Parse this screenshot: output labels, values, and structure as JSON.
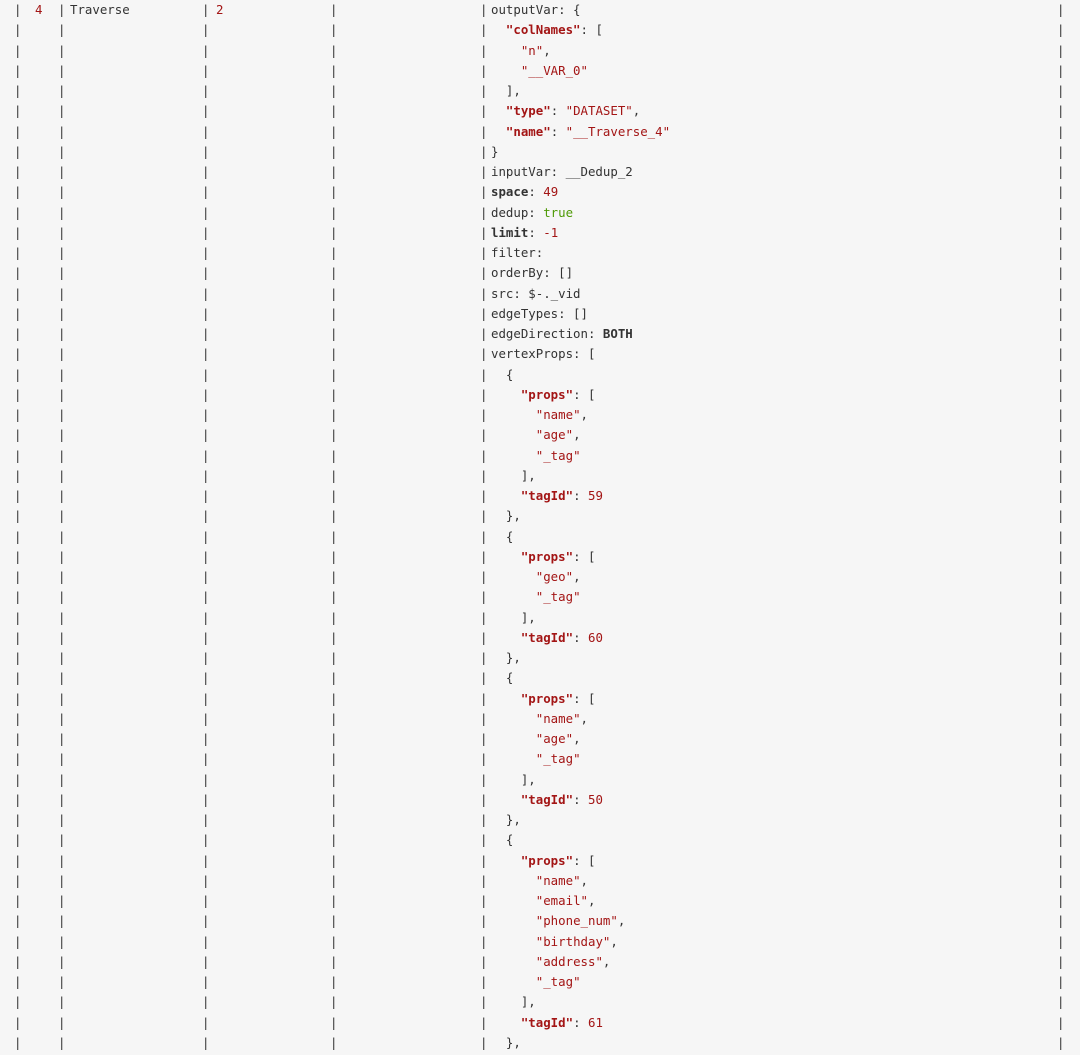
{
  "row": {
    "id": "4",
    "name": "Traverse",
    "dependencies": "2"
  },
  "operator_info": [
    [
      [
        "p",
        "outputVar: {"
      ]
    ],
    [
      [
        "p",
        "  "
      ],
      [
        "k",
        "\"colNames\""
      ],
      [
        "p",
        ": ["
      ]
    ],
    [
      [
        "p",
        "    "
      ],
      [
        "s",
        "\"n\""
      ],
      [
        "p",
        ","
      ]
    ],
    [
      [
        "p",
        "    "
      ],
      [
        "s",
        "\"__VAR_0\""
      ]
    ],
    [
      [
        "p",
        "  ],"
      ]
    ],
    [
      [
        "p",
        "  "
      ],
      [
        "k",
        "\"type\""
      ],
      [
        "p",
        ": "
      ],
      [
        "s",
        "\"DATASET\""
      ],
      [
        "p",
        ","
      ]
    ],
    [
      [
        "p",
        "  "
      ],
      [
        "k",
        "\"name\""
      ],
      [
        "p",
        ": "
      ],
      [
        "s",
        "\"__Traverse_4\""
      ]
    ],
    [
      [
        "p",
        "}"
      ]
    ],
    [
      [
        "p",
        "inputVar: __Dedup_2"
      ]
    ],
    [
      [
        "bold",
        "space"
      ],
      [
        "p",
        ": "
      ],
      [
        "n",
        "49"
      ]
    ],
    [
      [
        "p",
        "dedup: "
      ],
      [
        "b",
        "true"
      ]
    ],
    [
      [
        "bold",
        "limit"
      ],
      [
        "p",
        ": "
      ],
      [
        "n",
        "-1"
      ]
    ],
    [
      [
        "p",
        "filter:"
      ]
    ],
    [
      [
        "p",
        "orderBy: []"
      ]
    ],
    [
      [
        "p",
        "src: $-._vid"
      ]
    ],
    [
      [
        "p",
        "edgeTypes: []"
      ]
    ],
    [
      [
        "p",
        "edgeDirection: "
      ],
      [
        "bold",
        "BOTH"
      ]
    ],
    [
      [
        "p",
        "vertexProps: ["
      ]
    ],
    [
      [
        "p",
        "  {"
      ]
    ],
    [
      [
        "p",
        "    "
      ],
      [
        "k",
        "\"props\""
      ],
      [
        "p",
        ": ["
      ]
    ],
    [
      [
        "p",
        "      "
      ],
      [
        "s",
        "\"name\""
      ],
      [
        "p",
        ","
      ]
    ],
    [
      [
        "p",
        "      "
      ],
      [
        "s",
        "\"age\""
      ],
      [
        "p",
        ","
      ]
    ],
    [
      [
        "p",
        "      "
      ],
      [
        "s",
        "\"_tag\""
      ]
    ],
    [
      [
        "p",
        "    ],"
      ]
    ],
    [
      [
        "p",
        "    "
      ],
      [
        "k",
        "\"tagId\""
      ],
      [
        "p",
        ": "
      ],
      [
        "n",
        "59"
      ]
    ],
    [
      [
        "p",
        "  },"
      ]
    ],
    [
      [
        "p",
        "  {"
      ]
    ],
    [
      [
        "p",
        "    "
      ],
      [
        "k",
        "\"props\""
      ],
      [
        "p",
        ": ["
      ]
    ],
    [
      [
        "p",
        "      "
      ],
      [
        "s",
        "\"geo\""
      ],
      [
        "p",
        ","
      ]
    ],
    [
      [
        "p",
        "      "
      ],
      [
        "s",
        "\"_tag\""
      ]
    ],
    [
      [
        "p",
        "    ],"
      ]
    ],
    [
      [
        "p",
        "    "
      ],
      [
        "k",
        "\"tagId\""
      ],
      [
        "p",
        ": "
      ],
      [
        "n",
        "60"
      ]
    ],
    [
      [
        "p",
        "  },"
      ]
    ],
    [
      [
        "p",
        "  {"
      ]
    ],
    [
      [
        "p",
        "    "
      ],
      [
        "k",
        "\"props\""
      ],
      [
        "p",
        ": ["
      ]
    ],
    [
      [
        "p",
        "      "
      ],
      [
        "s",
        "\"name\""
      ],
      [
        "p",
        ","
      ]
    ],
    [
      [
        "p",
        "      "
      ],
      [
        "s",
        "\"age\""
      ],
      [
        "p",
        ","
      ]
    ],
    [
      [
        "p",
        "      "
      ],
      [
        "s",
        "\"_tag\""
      ]
    ],
    [
      [
        "p",
        "    ],"
      ]
    ],
    [
      [
        "p",
        "    "
      ],
      [
        "k",
        "\"tagId\""
      ],
      [
        "p",
        ": "
      ],
      [
        "n",
        "50"
      ]
    ],
    [
      [
        "p",
        "  },"
      ]
    ],
    [
      [
        "p",
        "  {"
      ]
    ],
    [
      [
        "p",
        "    "
      ],
      [
        "k",
        "\"props\""
      ],
      [
        "p",
        ": ["
      ]
    ],
    [
      [
        "p",
        "      "
      ],
      [
        "s",
        "\"name\""
      ],
      [
        "p",
        ","
      ]
    ],
    [
      [
        "p",
        "      "
      ],
      [
        "s",
        "\"email\""
      ],
      [
        "p",
        ","
      ]
    ],
    [
      [
        "p",
        "      "
      ],
      [
        "s",
        "\"phone_num\""
      ],
      [
        "p",
        ","
      ]
    ],
    [
      [
        "p",
        "      "
      ],
      [
        "s",
        "\"birthday\""
      ],
      [
        "p",
        ","
      ]
    ],
    [
      [
        "p",
        "      "
      ],
      [
        "s",
        "\"address\""
      ],
      [
        "p",
        ","
      ]
    ],
    [
      [
        "p",
        "      "
      ],
      [
        "s",
        "\"_tag\""
      ]
    ],
    [
      [
        "p",
        "    ],"
      ]
    ],
    [
      [
        "p",
        "    "
      ],
      [
        "k",
        "\"tagId\""
      ],
      [
        "p",
        ": "
      ],
      [
        "n",
        "61"
      ]
    ],
    [
      [
        "p",
        "  },"
      ]
    ]
  ],
  "colors": {
    "background": "#f6f6f6",
    "text": "#333333",
    "string": "#a31515",
    "boolean": "#4e9a06"
  }
}
